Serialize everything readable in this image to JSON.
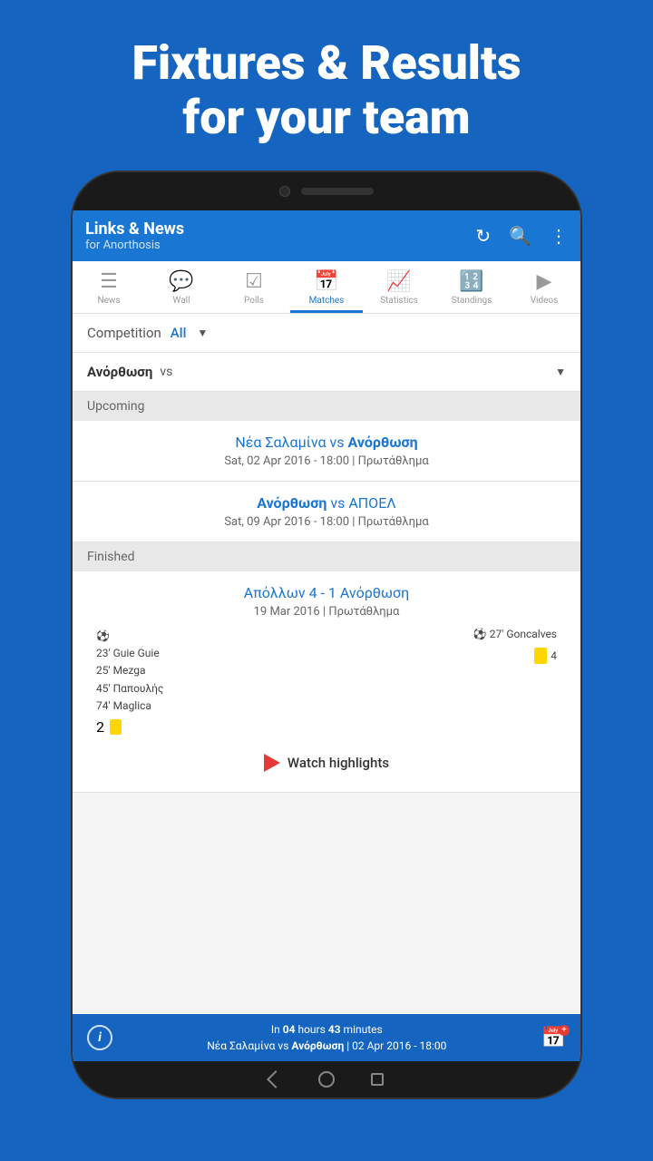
{
  "hero": {
    "line1": "Fixtures & Results",
    "line2": "for your team"
  },
  "app_header": {
    "title": "Links & News",
    "subtitle": "for Anorthosis"
  },
  "tabs": [
    {
      "label": "News",
      "icon": "📰",
      "active": false
    },
    {
      "label": "Wall",
      "icon": "📋",
      "active": false
    },
    {
      "label": "Polls",
      "icon": "☑",
      "active": false
    },
    {
      "label": "Matches",
      "icon": "📅",
      "active": true
    },
    {
      "label": "Statistics",
      "icon": "📈",
      "active": false
    },
    {
      "label": "Standings",
      "icon": "🔢",
      "active": false
    },
    {
      "label": "Videos",
      "icon": "▶",
      "active": false
    }
  ],
  "filter": {
    "label": "Competition",
    "value": "All"
  },
  "opponent_filter": {
    "label": "Ανόρθωση",
    "vs": "vs"
  },
  "upcoming": {
    "section_label": "Upcoming",
    "matches": [
      {
        "team1": "Νέα Σαλαμίνα",
        "vs": "vs",
        "team2": "Ανόρθωση",
        "team2_bold": true,
        "date": "Sat, 02 Apr 2016 - 18:00 | Πρωτάθλημα"
      },
      {
        "team1": "Ανόρθωση",
        "vs": "vs",
        "team2": "ΑΠΟΕΛ",
        "team1_bold": true,
        "date": "Sat, 09 Apr 2016 - 18:00 | Πρωτάθλημα"
      }
    ]
  },
  "finished": {
    "section_label": "Finished",
    "matches": [
      {
        "team1": "Απόλλων",
        "score1": "4",
        "dash": "-",
        "score2": "1",
        "team2": "Ανόρθωση",
        "team2_bold": true,
        "date": "19 Mar 2016 | Πρωτάθλημα",
        "goals_left": [
          "23' Guie Guie",
          "25' Mezga",
          "45' Παπουλής",
          "74' Maglica"
        ],
        "goals_right": [
          "27' Goncalves"
        ],
        "yellow_left": "2",
        "yellow_right": "4",
        "watch_highlights": "Watch highlights"
      }
    ]
  },
  "bottom_bar": {
    "countdown_text1": "In",
    "bold1": "04",
    "countdown_text2": "hours",
    "bold2": "43",
    "countdown_text3": "minutes",
    "match_info": "Νέα Σαλαμίνα vs Ανόρθωση | 02 Apr 2016 - 18:00"
  }
}
